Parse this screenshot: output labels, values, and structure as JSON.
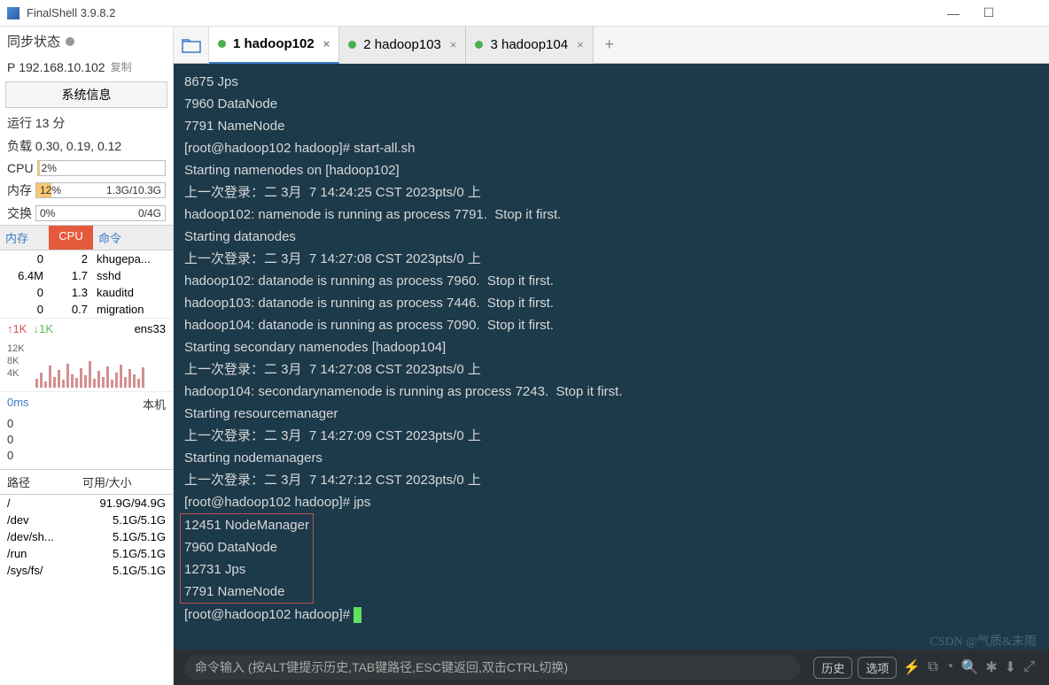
{
  "window": {
    "title": "FinalShell 3.9.8.2"
  },
  "sidebar": {
    "sync_label": "同步状态",
    "ip_prefix": "P",
    "ip": "192.168.10.102",
    "copy_label": "复制",
    "sysinfo_btn": "系统信息",
    "uptime_label": "运行",
    "uptime_value": "13 分",
    "load_label": "负载",
    "load_value": "0.30, 0.19, 0.12",
    "cpu_label": "CPU",
    "cpu_pct": "2%",
    "mem_label": "内存",
    "mem_pct": "12%",
    "mem_value": "1.3G/10.3G",
    "swap_label": "交换",
    "swap_pct": "0%",
    "swap_value": "0/4G",
    "proc_headers": {
      "mem": "内存",
      "cpu": "CPU",
      "cmd": "命令"
    },
    "procs": [
      {
        "mem": "0",
        "cpu": "2",
        "cmd": "khugepa..."
      },
      {
        "mem": "6.4M",
        "cpu": "1.7",
        "cmd": "sshd"
      },
      {
        "mem": "0",
        "cpu": "1.3",
        "cmd": "kauditd"
      },
      {
        "mem": "0",
        "cpu": "0.7",
        "cmd": "migration"
      }
    ],
    "net": {
      "up": "↑1K",
      "dn": "↓1K",
      "iface": "ens33",
      "y1": "12K",
      "y2": "8K",
      "y3": "4K"
    },
    "ping": {
      "ms": "0ms",
      "host": "本机",
      "v1": "0",
      "v2": "0",
      "v3": "0"
    },
    "fs_headers": {
      "path": "路径",
      "size": "可用/大小"
    },
    "fs": [
      {
        "path": "/",
        "size": "91.9G/94.9G"
      },
      {
        "path": "/dev",
        "size": "5.1G/5.1G"
      },
      {
        "path": "/dev/sh...",
        "size": "5.1G/5.1G"
      },
      {
        "path": "/run",
        "size": "5.1G/5.1G"
      },
      {
        "path": "/sys/fs/",
        "size": "5.1G/5.1G"
      }
    ]
  },
  "tabs": [
    {
      "label": "1 hadoop102",
      "active": true
    },
    {
      "label": "2 hadoop103",
      "active": false
    },
    {
      "label": "3 hadoop104",
      "active": false
    }
  ],
  "terminal": {
    "pre_lines": [
      "8675 Jps",
      "7960 DataNode",
      "7791 NameNode",
      "[root@hadoop102 hadoop]# start-all.sh",
      "Starting namenodes on [hadoop102]",
      "上一次登录：二 3月  7 14:24:25 CST 2023pts/0 上",
      "hadoop102: namenode is running as process 7791.  Stop it first.",
      "Starting datanodes",
      "上一次登录：二 3月  7 14:27:08 CST 2023pts/0 上",
      "hadoop102: datanode is running as process 7960.  Stop it first.",
      "hadoop103: datanode is running as process 7446.  Stop it first.",
      "hadoop104: datanode is running as process 7090.  Stop it first.",
      "Starting secondary namenodes [hadoop104]",
      "上一次登录：二 3月  7 14:27:08 CST 2023pts/0 上",
      "hadoop104: secondarynamenode is running as process 7243.  Stop it first.",
      "Starting resourcemanager",
      "上一次登录：二 3月  7 14:27:09 CST 2023pts/0 上",
      "Starting nodemanagers",
      "上一次登录：二 3月  7 14:27:12 CST 2023pts/0 上",
      "[root@hadoop102 hadoop]# jps"
    ],
    "boxed_lines": [
      "12451 NodeManager",
      "7960 DataNode",
      "12731 Jps",
      "7791 NameNode"
    ],
    "prompt": "[root@hadoop102 hadoop]# "
  },
  "bottombar": {
    "hint": "命令输入 (按ALT键提示历史,TAB键路径,ESC键返回,双击CTRL切换)",
    "history": "历史",
    "options": "选项"
  },
  "watermark": "CSDN @气质&末雨"
}
